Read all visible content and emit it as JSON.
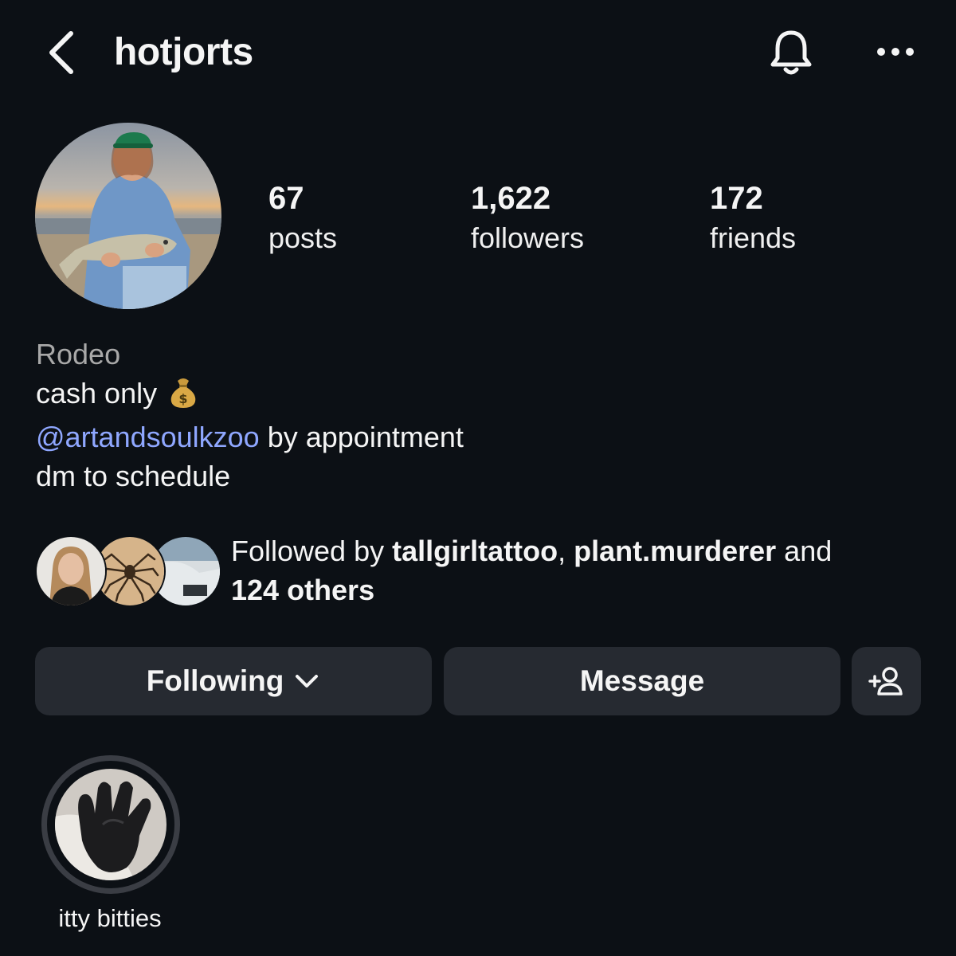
{
  "header": {
    "username": "hotjorts",
    "back_icon": "chevron-left-icon",
    "bell_icon": "bell-icon",
    "more_icon": "more-horizontal-icon"
  },
  "stats": [
    {
      "value": "67",
      "label": "posts"
    },
    {
      "value": "1,622",
      "label": "followers"
    },
    {
      "value": "172",
      "label": "friends"
    }
  ],
  "bio": {
    "name": "Rodeo",
    "line1": "cash only",
    "line1_emoji": "money-bag-icon",
    "mention": "@artandsoulkzoo",
    "line2_rest": " by appointment",
    "line3": "dm to schedule"
  },
  "followed_by": {
    "prefix": "Followed by ",
    "user1": "tallgirltattoo",
    "sep": ", ",
    "user2": "plant.murderer",
    "conj": " and",
    "others": "124 others"
  },
  "actions": {
    "following_label": "Following",
    "message_label": "Message",
    "add_user_icon": "add-person-icon"
  },
  "highlights": [
    {
      "label": "itty bitties"
    }
  ],
  "colors": {
    "background": "#0c1015",
    "button": "#262a31",
    "mention": "#8fa7ff",
    "muted": "#a8a8a8"
  }
}
